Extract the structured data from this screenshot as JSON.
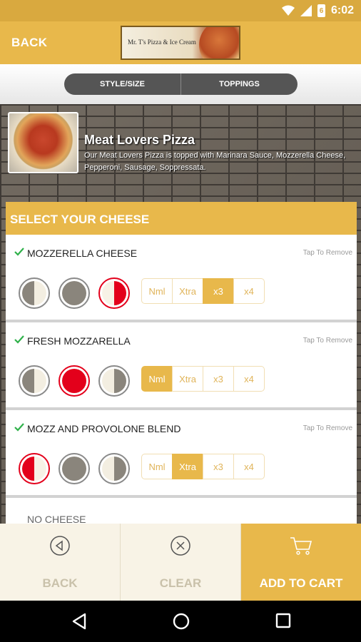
{
  "status": {
    "time": "6:02",
    "battery": "6"
  },
  "appbar": {
    "back_label": "BACK",
    "logo_text": "Mr. T's Pizza & Ice Cream"
  },
  "tabs": [
    {
      "label": "STYLE/SIZE"
    },
    {
      "label": "TOPPINGS"
    }
  ],
  "item": {
    "title": "Meat Lovers Pizza",
    "description": "Our Meat Lovers Pizza is topped with Marinara Sauce, Mozzerella Cheese, Pepperoni, Sausage, Soppressata."
  },
  "section": {
    "title": "SELECT YOUR CHEESE"
  },
  "options": [
    {
      "name": "MOZZERELLA CHEESE",
      "tap_text": "Tap To Remove",
      "portion": "right",
      "amount_selected": "x3",
      "amounts": [
        "Nml",
        "Xtra",
        "x3",
        "x4"
      ]
    },
    {
      "name": "FRESH MOZZARELLA",
      "tap_text": "Tap To Remove",
      "portion": "whole",
      "amount_selected": "Nml",
      "amounts": [
        "Nml",
        "Xtra",
        "x3",
        "x4"
      ]
    },
    {
      "name": "MOZZ AND PROVOLONE BLEND",
      "tap_text": "Tap To Remove",
      "portion": "left",
      "amount_selected": "Xtra",
      "amounts": [
        "Nml",
        "Xtra",
        "x3",
        "x4"
      ]
    },
    {
      "name": "NO CHEESE"
    }
  ],
  "bottom": {
    "back_label": "BACK",
    "clear_label": "CLEAR",
    "cart_label": "ADD TO CART"
  },
  "colors": {
    "accent": "#e8b84b",
    "selected": "#e3001b",
    "check": "#2fb14a"
  }
}
